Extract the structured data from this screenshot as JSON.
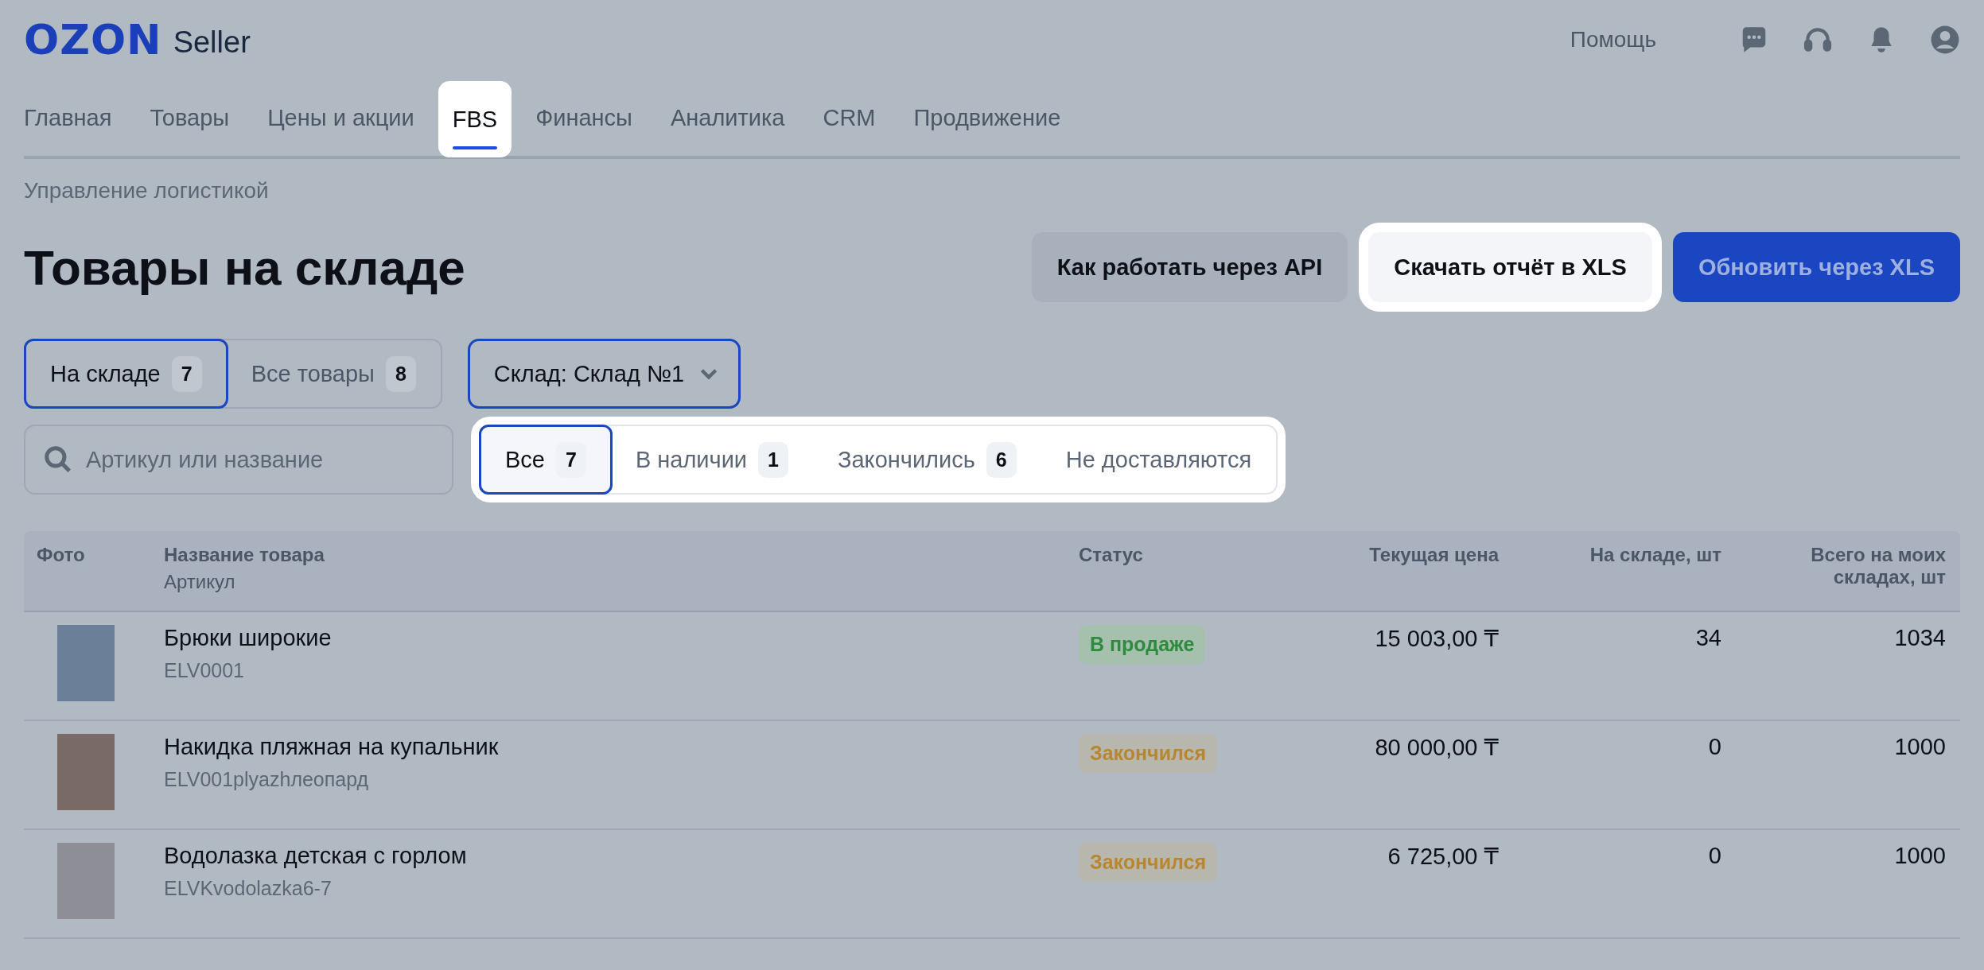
{
  "header": {
    "logo": "OZON",
    "logo_suffix": "Seller",
    "help_link": "Помощь"
  },
  "nav": [
    {
      "label": "Главная",
      "selected": false,
      "highlighted": false
    },
    {
      "label": "Товары",
      "selected": false,
      "highlighted": false
    },
    {
      "label": "Цены и акции",
      "selected": false,
      "highlighted": false
    },
    {
      "label": "FBS",
      "selected": true,
      "highlighted": true
    },
    {
      "label": "Финансы",
      "selected": false,
      "highlighted": false
    },
    {
      "label": "Аналитика",
      "selected": false,
      "highlighted": false
    },
    {
      "label": "CRM",
      "selected": false,
      "highlighted": false
    },
    {
      "label": "Продвижение",
      "selected": false,
      "highlighted": false
    }
  ],
  "breadcrumb": "Управление логистикой",
  "title": "Товары на складе",
  "actions": [
    {
      "label": "Как работать через API",
      "kind": "secondary",
      "highlighted": false
    },
    {
      "label": "Скачать отчёт в XLS",
      "kind": "light",
      "highlighted": true
    },
    {
      "label": "Обновить через XLS",
      "kind": "primary",
      "highlighted": false
    }
  ],
  "view_toggle": [
    {
      "label": "На складе",
      "count": "7",
      "selected": true
    },
    {
      "label": "Все товары",
      "count": "8",
      "selected": false
    }
  ],
  "warehouse_select": {
    "label": "Склад: Склад №1"
  },
  "search": {
    "placeholder": "Артикул или название"
  },
  "status_filters": {
    "highlighted": true,
    "items": [
      {
        "label": "Все",
        "count": "7",
        "selected": true
      },
      {
        "label": "В наличии",
        "count": "1",
        "selected": false
      },
      {
        "label": "Закончились",
        "count": "6",
        "selected": false
      },
      {
        "label": "Не доставляются",
        "selected": false
      }
    ]
  },
  "table": {
    "columns": [
      {
        "label": "Фото"
      },
      {
        "label": "Название товара",
        "sublabel": "Артикул"
      },
      {
        "label": "Статус"
      },
      {
        "label": "Текущая цена"
      },
      {
        "label": "На складе, шт"
      },
      {
        "label": "Всего на моих складах, шт"
      }
    ],
    "rows": [
      {
        "name": "Брюки широкие",
        "sku": "ELV0001",
        "status": {
          "label": "В продаже",
          "kind": "on_sale"
        },
        "price": "15 003,00 ₸",
        "stock": "34",
        "total": "1034"
      },
      {
        "name": "Накидка пляжная на купальник",
        "sku": "ELV001plyazhлеопард",
        "status": {
          "label": "Закончился",
          "kind": "out"
        },
        "price": "80 000,00 ₸",
        "stock": "0",
        "total": "1000"
      },
      {
        "name": "Водолазка детская с горлом",
        "sku": "ELVKvodolazka6-7",
        "status": {
          "label": "Закончился",
          "kind": "out"
        },
        "price": "6 725,00 ₸",
        "stock": "0",
        "total": "1000"
      }
    ]
  }
}
